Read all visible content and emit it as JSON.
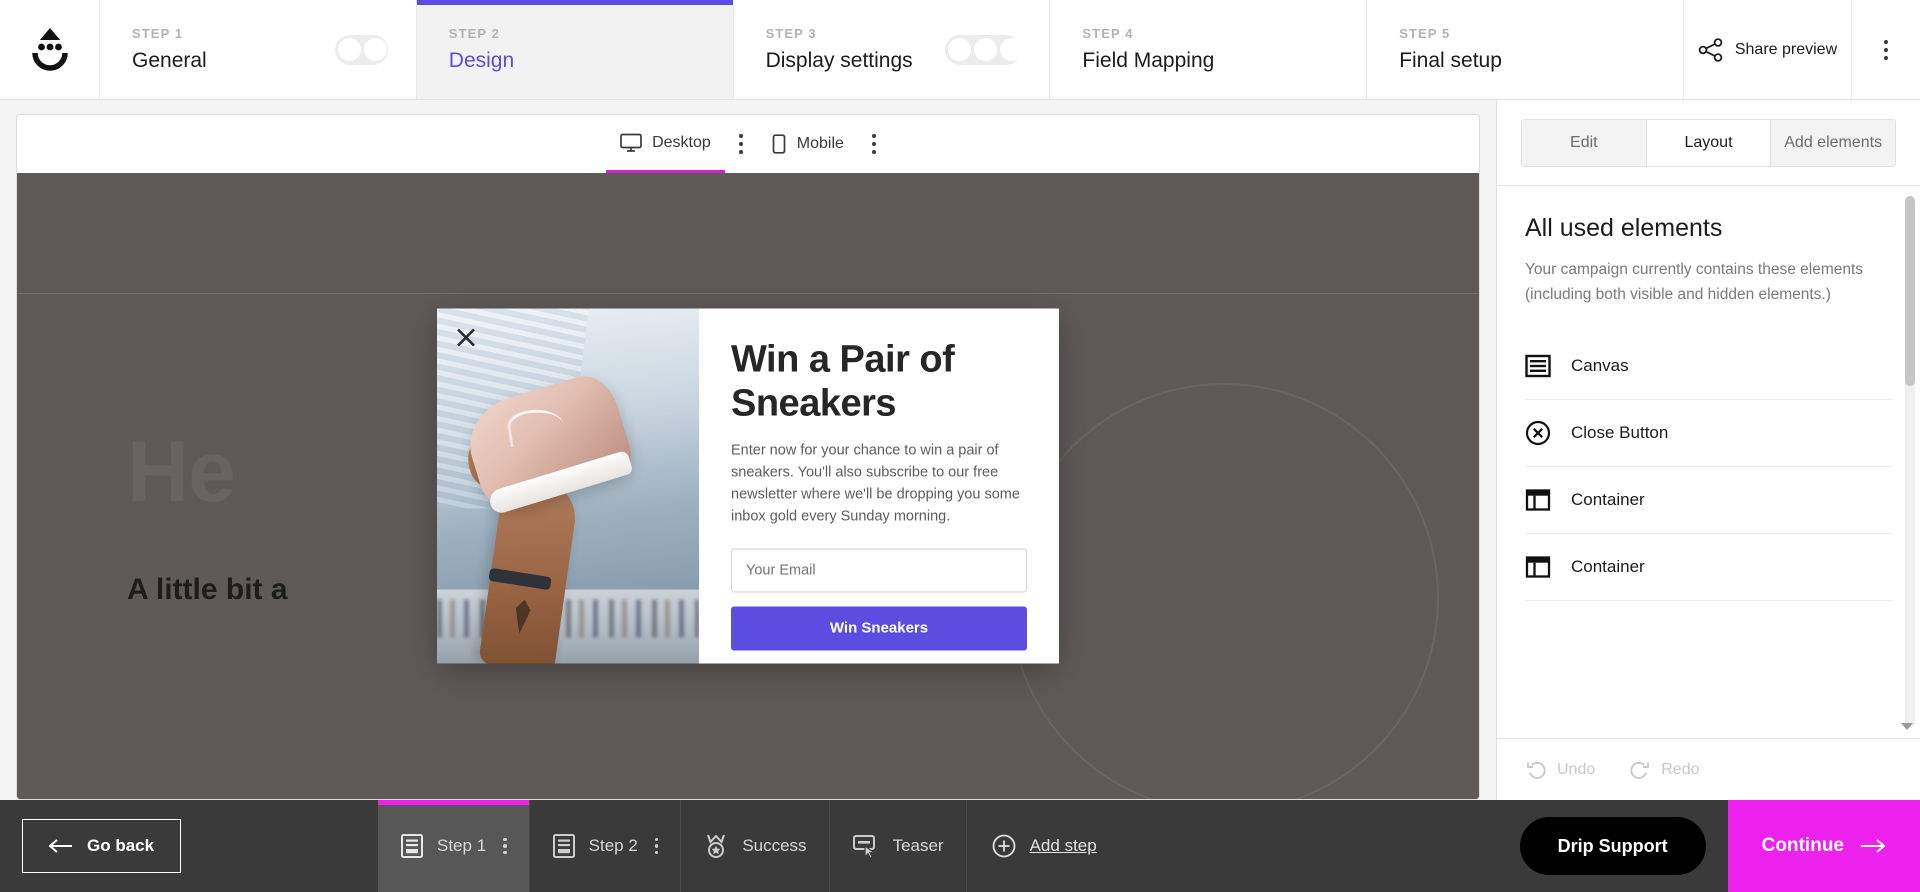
{
  "app": {
    "logo_name": "drip-logo"
  },
  "wizard": {
    "steps": [
      {
        "kicker": "STEP 1",
        "title": "General",
        "active": false,
        "toggle_dots": 2
      },
      {
        "kicker": "STEP 2",
        "title": "Design",
        "active": true,
        "toggle_dots": 0
      },
      {
        "kicker": "STEP 3",
        "title": "Display settings",
        "active": false,
        "toggle_dots": 3
      },
      {
        "kicker": "STEP 4",
        "title": "Field Mapping",
        "active": false,
        "toggle_dots": 0
      },
      {
        "kicker": "STEP 5",
        "title": "Final setup",
        "active": false,
        "toggle_dots": 0
      }
    ],
    "share_preview_label": "Share preview",
    "active_accent": "#5b4de0"
  },
  "device_tabs": [
    {
      "label": "Desktop",
      "icon": "monitor-icon",
      "selected": true
    },
    {
      "label": "Mobile",
      "icon": "phone-icon",
      "selected": false
    }
  ],
  "preview": {
    "background_color": "#5f5a58",
    "ghost_headline": "He",
    "ghost_subheadline": "A little bit a",
    "popup": {
      "close_icon": "close-x-icon",
      "heading": "Win a Pair of Sneakers",
      "paragraph": "Enter now for your chance to win a pair of sneakers. You'll also subscribe to our free newsletter where we'll be dropping you some inbox gold every Sunday morning.",
      "email_placeholder": "Your Email",
      "email_value": "",
      "submit_label": "Win Sneakers",
      "submit_color": "#5b4de0"
    }
  },
  "right_panel": {
    "tabs": [
      {
        "label": "Edit",
        "active": false
      },
      {
        "label": "Layout",
        "active": true
      },
      {
        "label": "Add elements",
        "active": false
      }
    ],
    "title": "All used elements",
    "description": "Your campaign currently contains these elements (including both visible and hidden elements.)",
    "elements": [
      {
        "label": "Canvas",
        "icon": "canvas-icon"
      },
      {
        "label": "Close Button",
        "icon": "close-circle-icon"
      },
      {
        "label": "Container",
        "icon": "container-icon"
      },
      {
        "label": "Container",
        "icon": "container-icon"
      }
    ],
    "undo_label": "Undo",
    "redo_label": "Redo"
  },
  "bottom_bar": {
    "go_back_label": "Go back",
    "steps": [
      {
        "label": "Step 1",
        "icon": "step-page-icon",
        "active": true,
        "has_kebab": true
      },
      {
        "label": "Step 2",
        "icon": "step-page-icon",
        "active": false,
        "has_kebab": true
      },
      {
        "label": "Success",
        "icon": "medal-icon",
        "active": false,
        "has_kebab": false
      },
      {
        "label": "Teaser",
        "icon": "teaser-icon",
        "active": false,
        "has_kebab": false
      }
    ],
    "add_step_label": "Add step",
    "support_label": "Drip Support",
    "continue_label": "Continue",
    "accent_color": "#ee20ee"
  }
}
